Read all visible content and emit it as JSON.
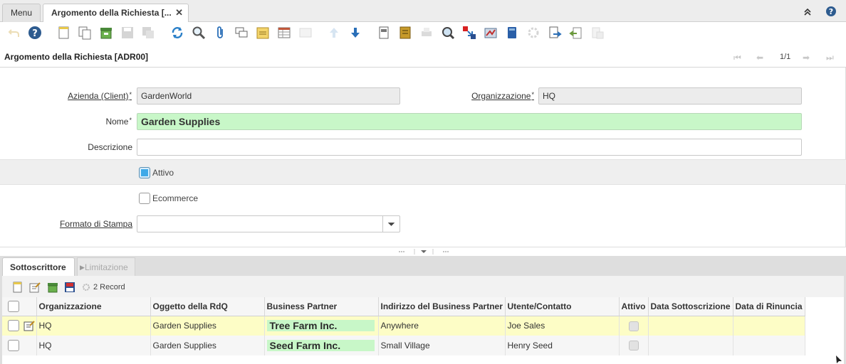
{
  "window_tabs": {
    "menu_label": "Menu",
    "active_label": "Argomento della Richiesta [..."
  },
  "title": "Argomento della Richiesta [ADR00]",
  "navigation": {
    "page": "1/1"
  },
  "form": {
    "client": {
      "label": "Azienda (Client)",
      "value": "GardenWorld"
    },
    "org": {
      "label": "Organizzazione",
      "value": "HQ"
    },
    "name": {
      "label": "Nome",
      "value": "Garden Supplies"
    },
    "description": {
      "label": "Descrizione",
      "value": ""
    },
    "active": {
      "label": "Attivo",
      "checked": true
    },
    "ecommerce": {
      "label": "Ecommerce",
      "checked": false
    },
    "print_format": {
      "label": "Formato di Stampa",
      "value": ""
    }
  },
  "detail": {
    "tabs": [
      "Sottoscrittore",
      "Limitazione"
    ],
    "record_count": "2 Record",
    "columns": [
      "Organizzazione",
      "Oggetto della RdQ",
      "Business Partner",
      "Indirizzo del Business Partner",
      "Utente/Contatto",
      "Attivo",
      "Data Sottoscrizione",
      "Data di Rinuncia"
    ],
    "rows": [
      {
        "org": "HQ",
        "subject": "Garden Supplies",
        "bp": "Tree Farm Inc.",
        "address": "Anywhere",
        "contact": "Joe Sales",
        "active": true,
        "subscribe_date": "",
        "optout_date": ""
      },
      {
        "org": "HQ",
        "subject": "Garden Supplies",
        "bp": "Seed Farm Inc.",
        "address": "Small Village",
        "contact": "Henry Seed",
        "active": true,
        "subscribe_date": "",
        "optout_date": ""
      }
    ]
  },
  "icons": {
    "toolbar": [
      "undo-icon",
      "help-icon",
      "new-record-icon",
      "copy-record-icon",
      "delete-icon",
      "save-icon",
      "save-and-create-icon",
      "refresh-icon",
      "find-icon",
      "attachment-icon",
      "chat-icon",
      "postit-icon",
      "grid-toggle-icon",
      "parent-record-icon",
      "previous-record-icon",
      "next-record-icon",
      "report-icon",
      "archive-icon",
      "print-icon",
      "zoom-across-icon",
      "request-icon",
      "product-info-icon",
      "workflow-icon",
      "process-icon",
      "import-icon",
      "export-icon",
      "customize-icon"
    ],
    "accent": "#3fa9e8",
    "mandatory_bg": "#c8f7c8",
    "selected_row_bg": "#fdfdc6"
  }
}
